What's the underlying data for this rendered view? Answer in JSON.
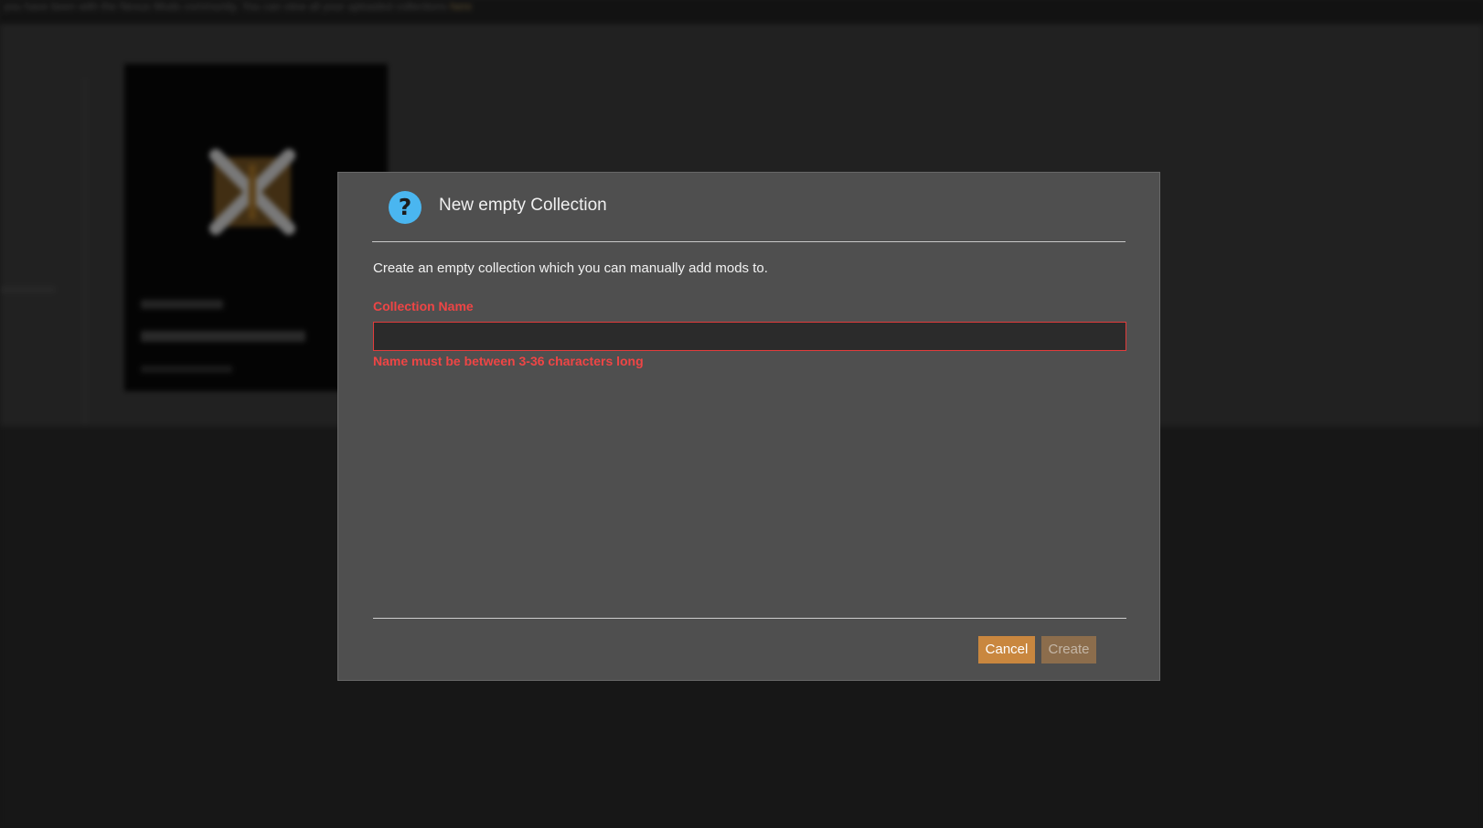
{
  "background": {
    "banner_text": "you have been with the Nexus Mods community. You can view all your uploaded collections",
    "banner_link": "here",
    "card": {
      "tag": "VORTEX",
      "title": "Image Text for the App",
      "subtitle": "by a contributor"
    }
  },
  "dialog": {
    "icon": "question-mark-icon",
    "title": "New empty Collection",
    "description": "Create an empty collection which you can manually add mods to.",
    "field_label": "Collection Name",
    "input_value": "",
    "input_placeholder": "",
    "error_message": "Name must be between 3-36 characters long",
    "buttons": {
      "cancel": "Cancel",
      "create": "Create"
    }
  },
  "colors": {
    "dialog_bg": "#4f4f4f",
    "accent": "#c9873f",
    "error": "#ef4545",
    "info_icon": "#4ab6f0"
  }
}
